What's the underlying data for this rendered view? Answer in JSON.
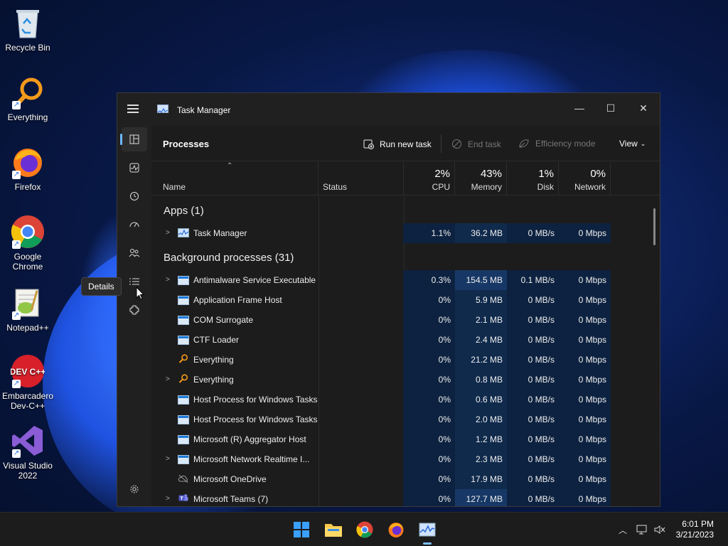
{
  "desktop": {
    "icons": [
      {
        "label": "Recycle Bin",
        "icon": "recycle-bin-icon"
      },
      {
        "label": "Everything",
        "icon": "everything-icon"
      },
      {
        "label": "Firefox",
        "icon": "firefox-icon"
      },
      {
        "label": "Google Chrome",
        "icon": "chrome-icon"
      },
      {
        "label": "Notepad++",
        "icon": "notepadpp-icon"
      },
      {
        "label": "Embarcadero Dev-C++",
        "icon": "devcpp-icon"
      },
      {
        "label": "Visual Studio 2022",
        "icon": "visual-studio-icon"
      }
    ],
    "devcpp_logo_text": "DEV C++"
  },
  "window": {
    "title": "Task Manager",
    "controls": {
      "minimize": "—",
      "maximize": "☐",
      "close": "✕"
    }
  },
  "toolbar": {
    "page_title": "Processes",
    "run_new_task": "Run new task",
    "end_task": "End task",
    "efficiency_mode": "Efficiency mode",
    "view": "View"
  },
  "columns": {
    "name": "Name",
    "status": "Status",
    "cpu": {
      "label": "CPU",
      "value": "2%"
    },
    "memory": {
      "label": "Memory",
      "value": "43%"
    },
    "disk": {
      "label": "Disk",
      "value": "1%"
    },
    "network": {
      "label": "Network",
      "value": "0%"
    }
  },
  "groups": {
    "apps": "Apps (1)",
    "background": "Background processes (31)"
  },
  "apps": [
    {
      "name": "Task Manager",
      "cpu": "1.1%",
      "mem": "36.2 MB",
      "disk": "0 MB/s",
      "net": "0 Mbps",
      "expandable": true,
      "icon": "taskmanager"
    }
  ],
  "background": [
    {
      "name": "Antimalware Service Executable",
      "cpu": "0.3%",
      "mem": "154.5 MB",
      "disk": "0.1 MB/s",
      "net": "0 Mbps",
      "expandable": true,
      "icon": "window"
    },
    {
      "name": "Application Frame Host",
      "cpu": "0%",
      "mem": "5.9 MB",
      "disk": "0 MB/s",
      "net": "0 Mbps",
      "expandable": false,
      "icon": "window"
    },
    {
      "name": "COM Surrogate",
      "cpu": "0%",
      "mem": "2.1 MB",
      "disk": "0 MB/s",
      "net": "0 Mbps",
      "expandable": false,
      "icon": "window"
    },
    {
      "name": "CTF Loader",
      "cpu": "0%",
      "mem": "2.4 MB",
      "disk": "0 MB/s",
      "net": "0 Mbps",
      "expandable": false,
      "icon": "window"
    },
    {
      "name": "Everything",
      "cpu": "0%",
      "mem": "21.2 MB",
      "disk": "0 MB/s",
      "net": "0 Mbps",
      "expandable": false,
      "icon": "everything"
    },
    {
      "name": "Everything",
      "cpu": "0%",
      "mem": "0.8 MB",
      "disk": "0 MB/s",
      "net": "0 Mbps",
      "expandable": true,
      "icon": "everything"
    },
    {
      "name": "Host Process for Windows Tasks",
      "cpu": "0%",
      "mem": "0.6 MB",
      "disk": "0 MB/s",
      "net": "0 Mbps",
      "expandable": false,
      "icon": "window"
    },
    {
      "name": "Host Process for Windows Tasks",
      "cpu": "0%",
      "mem": "2.0 MB",
      "disk": "0 MB/s",
      "net": "0 Mbps",
      "expandable": false,
      "icon": "window"
    },
    {
      "name": "Microsoft (R) Aggregator Host",
      "cpu": "0%",
      "mem": "1.2 MB",
      "disk": "0 MB/s",
      "net": "0 Mbps",
      "expandable": false,
      "icon": "window"
    },
    {
      "name": "Microsoft Network Realtime I...",
      "cpu": "0%",
      "mem": "2.3 MB",
      "disk": "0 MB/s",
      "net": "0 Mbps",
      "expandable": true,
      "icon": "window"
    },
    {
      "name": "Microsoft OneDrive",
      "cpu": "0%",
      "mem": "17.9 MB",
      "disk": "0 MB/s",
      "net": "0 Mbps",
      "expandable": false,
      "icon": "onedrive"
    },
    {
      "name": "Microsoft Teams (7)",
      "cpu": "0%",
      "mem": "127.7 MB",
      "disk": "0 MB/s",
      "net": "0 Mbps",
      "expandable": true,
      "icon": "teams"
    }
  ],
  "tooltip": "Details",
  "taskbar": {
    "time": "6:01 PM",
    "date": "3/21/2023"
  },
  "colors": {
    "accent": "#6cb8ff",
    "heat_light": "#102a4c",
    "heat_mid": "#173866",
    "heat_dark": "#0d2240"
  }
}
